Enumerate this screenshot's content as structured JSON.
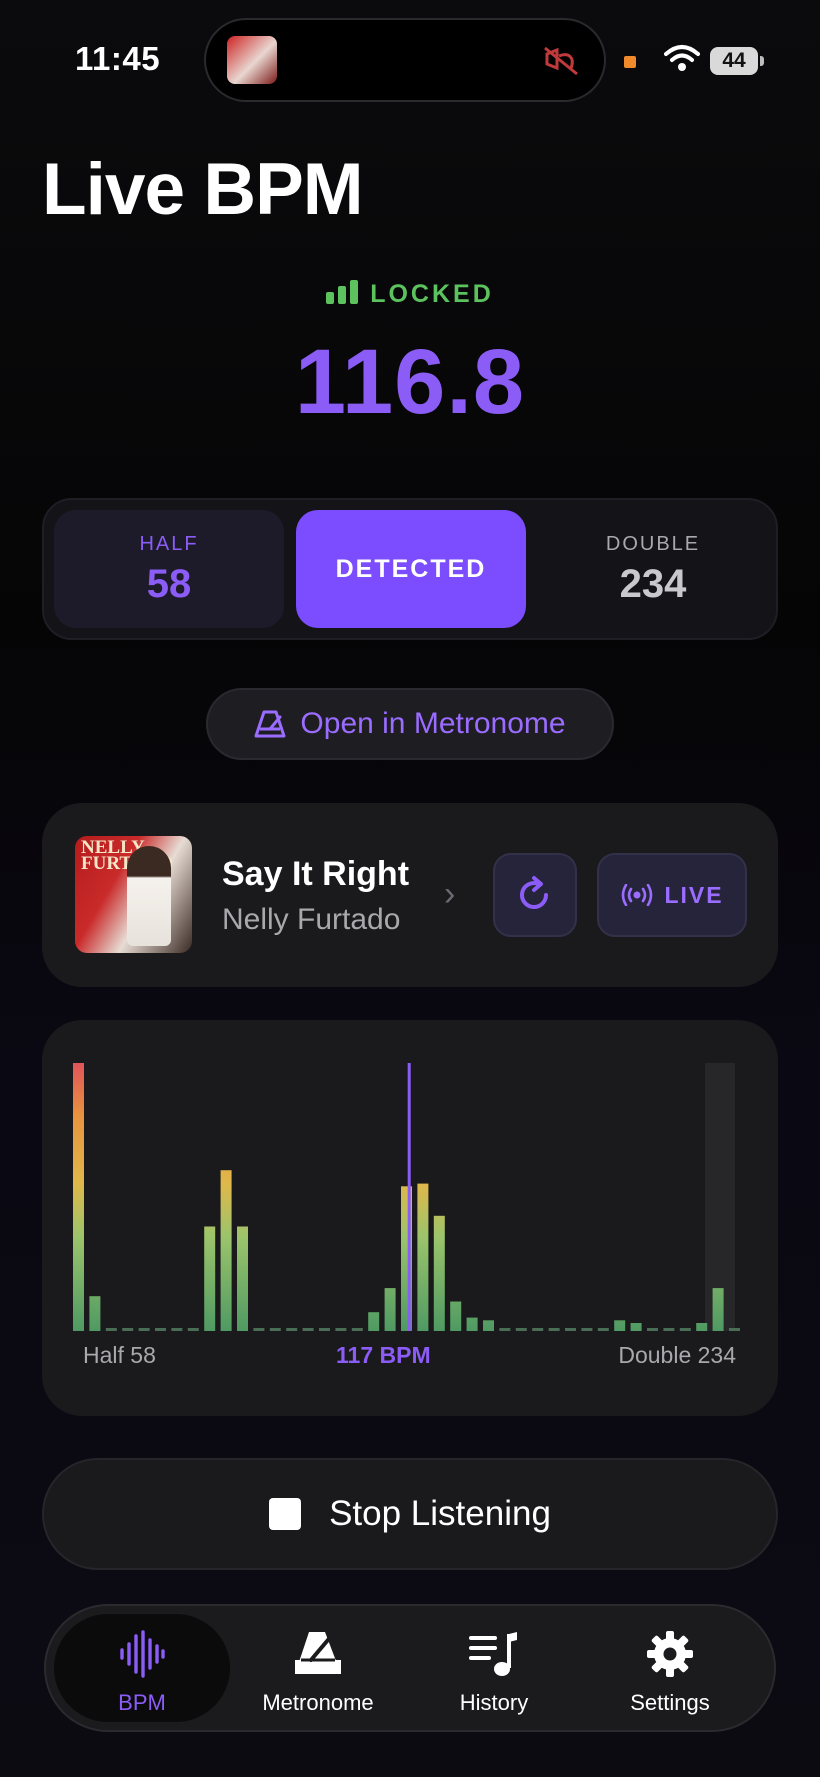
{
  "status_bar": {
    "time": "11:45",
    "battery": "44",
    "colors": {
      "recording_dot": "#f08a2a"
    }
  },
  "header": {
    "title": "Live BPM"
  },
  "detection": {
    "status": "LOCKED",
    "status_color": "#5cc25e",
    "bpm": "116.8",
    "accent": "#8b5cf6"
  },
  "segmented": {
    "half": {
      "label": "HALF",
      "value": "58"
    },
    "detected": {
      "label": "DETECTED"
    },
    "double": {
      "label": "DOUBLE",
      "value": "234"
    }
  },
  "metronome_button": {
    "label": "Open in Metronome"
  },
  "track": {
    "album_text": "NELLY FURTADO",
    "title": "Say It Right",
    "artist": "Nelly Furtado",
    "live_label": "LIVE"
  },
  "histogram": {
    "left_label": "Half 58",
    "center_label": "117 BPM",
    "right_label": "Double 234",
    "levels": [
      1.0,
      0.13,
      0.01,
      0.01,
      0.01,
      0.01,
      0.01,
      0.01,
      0.39,
      0.6,
      0.39,
      0.01,
      0.01,
      0.01,
      0.01,
      0.01,
      0.01,
      0.01,
      0.07,
      0.16,
      0.54,
      0.55,
      0.43,
      0.11,
      0.05,
      0.04,
      0.01,
      0.01,
      0.01,
      0.01,
      0.01,
      0.01,
      0.01,
      0.04,
      0.03,
      0.01,
      0.01,
      0.01,
      0.03,
      0.16,
      0.01
    ],
    "marker_index": 20.5
  },
  "stop_button": {
    "label": "Stop Listening"
  },
  "tabs": [
    {
      "label": "BPM",
      "icon": "waveform-icon",
      "active": true
    },
    {
      "label": "Metronome",
      "icon": "metronome-icon",
      "active": false
    },
    {
      "label": "History",
      "icon": "music-list-icon",
      "active": false
    },
    {
      "label": "Settings",
      "icon": "gear-icon",
      "active": false
    }
  ]
}
